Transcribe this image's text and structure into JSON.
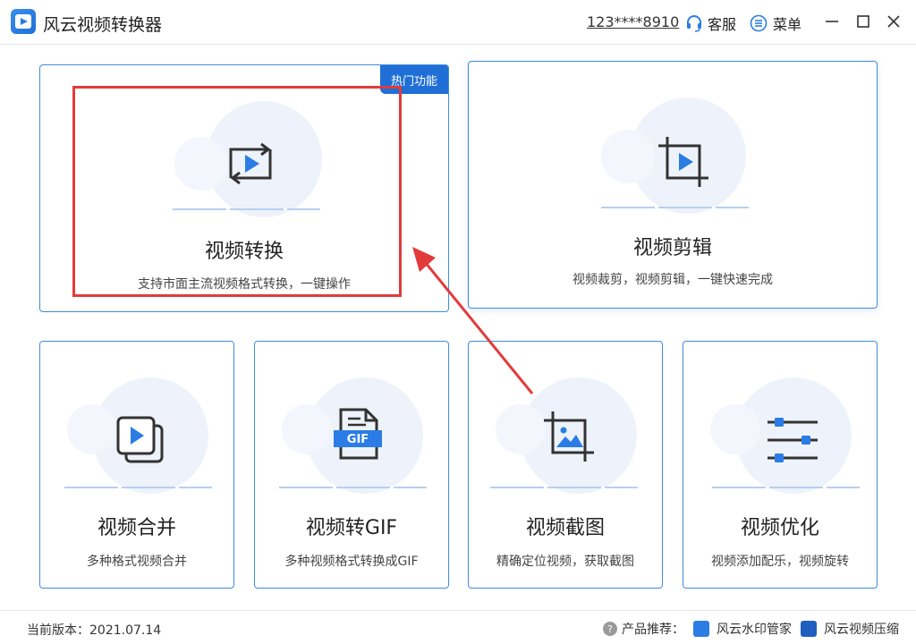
{
  "window": {
    "title": "风云视频转换器",
    "account": "123****8910",
    "support_label": "客服",
    "menu_label": "菜单"
  },
  "cards": {
    "convert": {
      "title": "视频转换",
      "desc": "支持市面主流视频格式转换，一键操作",
      "badge": "热门功能"
    },
    "edit": {
      "title": "视频剪辑",
      "desc": "视频裁剪，视频剪辑，一键快速完成"
    },
    "merge": {
      "title": "视频合并",
      "desc": "多种格式视频合并"
    },
    "gif": {
      "title": "视频转GIF",
      "desc": "多种视频格式转换成GIF",
      "icon_text": "GIF"
    },
    "snapshot": {
      "title": "视频截图",
      "desc": "精确定位视频，获取截图"
    },
    "optimize": {
      "title": "视频优化",
      "desc": "视频添加配乐，视频旋转"
    }
  },
  "footer": {
    "version_label": "当前版本：2021.07.14",
    "recommend_label": "产品推荐：",
    "products": [
      "风云水印管家",
      "风云视频压缩"
    ]
  },
  "icons": {
    "logo": "app-logo-icon",
    "support": "headset-icon",
    "menu": "list-menu-icon",
    "convert": "convert-loop-play-icon",
    "edit": "crop-play-icon",
    "merge": "stacked-play-icon",
    "gif": "gif-file-icon",
    "snapshot": "crop-image-icon",
    "optimize": "sliders-icon",
    "help": "question-icon"
  },
  "colors": {
    "accent": "#1f6fd6",
    "card_border": "#3f8be0",
    "annotation": "#e23b3b"
  }
}
